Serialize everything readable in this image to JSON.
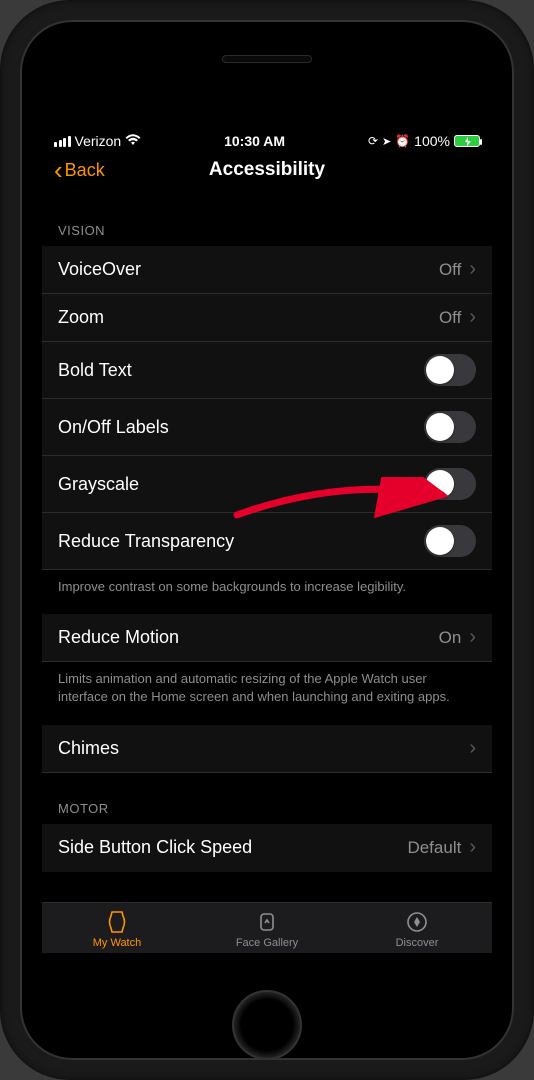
{
  "status": {
    "carrier": "Verizon",
    "time": "10:30 AM",
    "battery_pct": "100%"
  },
  "nav": {
    "back_label": "Back",
    "title": "Accessibility"
  },
  "sections": {
    "vision_header": "VISION",
    "motor_header": "MOTOR"
  },
  "rows": {
    "voiceover": {
      "label": "VoiceOver",
      "value": "Off"
    },
    "zoom": {
      "label": "Zoom",
      "value": "Off"
    },
    "bold_text": {
      "label": "Bold Text"
    },
    "onoff_labels": {
      "label": "On/Off Labels"
    },
    "grayscale": {
      "label": "Grayscale"
    },
    "reduce_transparency": {
      "label": "Reduce Transparency"
    },
    "reduce_motion": {
      "label": "Reduce Motion",
      "value": "On"
    },
    "chimes": {
      "label": "Chimes"
    },
    "side_button": {
      "label": "Side Button Click Speed",
      "value": "Default"
    }
  },
  "footers": {
    "transparency": "Improve contrast on some backgrounds to increase legibility.",
    "motion": "Limits animation and automatic resizing of the Apple Watch user interface on the Home screen and when launching and exiting apps."
  },
  "tabs": {
    "my_watch": "My Watch",
    "face_gallery": "Face Gallery",
    "discover": "Discover"
  }
}
